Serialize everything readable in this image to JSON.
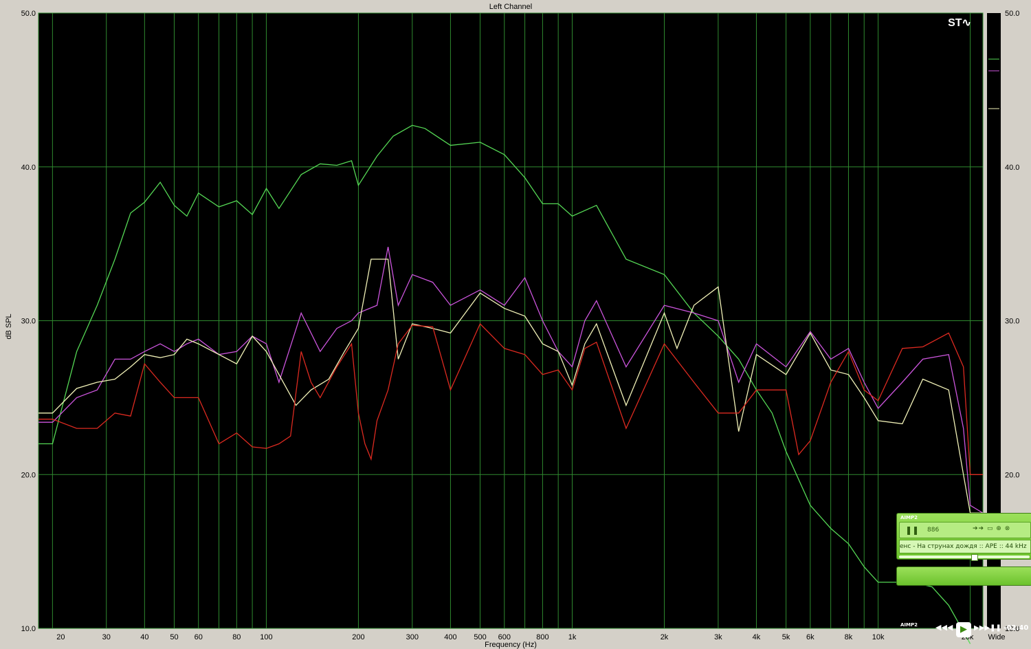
{
  "chart_data": {
    "type": "line",
    "title": "Left Channel",
    "xlabel": "Frequency (Hz)",
    "ylabel": "dB SPL",
    "xscale": "log",
    "xlim": [
      18,
      22000
    ],
    "ylim": [
      10,
      50
    ],
    "x_ticks": [
      {
        "v": 20,
        "label": "20"
      },
      {
        "v": 30,
        "label": "30"
      },
      {
        "v": 40,
        "label": "40"
      },
      {
        "v": 50,
        "label": "50"
      },
      {
        "v": 60,
        "label": "60"
      },
      {
        "v": 80,
        "label": "80"
      },
      {
        "v": 100,
        "label": "100"
      },
      {
        "v": 200,
        "label": "200"
      },
      {
        "v": 300,
        "label": "300"
      },
      {
        "v": 400,
        "label": "400"
      },
      {
        "v": 500,
        "label": "500"
      },
      {
        "v": 600,
        "label": "600"
      },
      {
        "v": 800,
        "label": "800"
      },
      {
        "v": 1000,
        "label": "1k"
      },
      {
        "v": 2000,
        "label": "2k"
      },
      {
        "v": 3000,
        "label": "3k"
      },
      {
        "v": 4000,
        "label": "4k"
      },
      {
        "v": 5000,
        "label": "5k"
      },
      {
        "v": 6000,
        "label": "6k"
      },
      {
        "v": 8000,
        "label": "8k"
      },
      {
        "v": 10000,
        "label": "10k"
      },
      {
        "v": 20000,
        "label": "20k"
      }
    ],
    "y_ticks": [
      {
        "v": 50,
        "label": "50.0"
      },
      {
        "v": 40,
        "label": "40.0"
      },
      {
        "v": 30,
        "label": "30.0"
      },
      {
        "v": 20,
        "label": "20.0"
      },
      {
        "v": 10,
        "label": "10.0"
      }
    ],
    "right_axis_extra_label": "Wide",
    "grid": true,
    "series": [
      {
        "color": "#55d855",
        "x": [
          18,
          20,
          24,
          28,
          32,
          36,
          40,
          45,
          50,
          55,
          60,
          70,
          80,
          90,
          100,
          110,
          130,
          150,
          170,
          190,
          200,
          230,
          260,
          300,
          330,
          400,
          500,
          600,
          700,
          800,
          900,
          1000,
          1200,
          1500,
          2000,
          2500,
          3000,
          3500,
          4000,
          4500,
          5000,
          6000,
          7000,
          8000,
          9000,
          10000,
          11000,
          13000,
          15000,
          17000,
          20000
        ],
        "y": [
          22,
          22,
          28,
          31,
          34,
          37,
          37.7,
          39,
          37.5,
          36.8,
          38.3,
          37.4,
          37.8,
          36.9,
          38.6,
          37.3,
          39.5,
          40.2,
          40.1,
          40.4,
          38.8,
          40.7,
          42,
          42.7,
          42.5,
          41.4,
          41.6,
          40.8,
          39.3,
          37.6,
          37.6,
          36.8,
          37.5,
          34,
          33,
          30.5,
          29,
          27.5,
          25.5,
          24,
          21.5,
          18,
          16.5,
          15.5,
          14,
          13,
          13,
          13,
          12.7,
          11.5,
          9
        ]
      },
      {
        "color": "#cc55dd",
        "x": [
          18,
          20,
          24,
          28,
          32,
          36,
          40,
          45,
          50,
          55,
          60,
          70,
          80,
          90,
          100,
          110,
          130,
          150,
          170,
          190,
          200,
          230,
          250,
          270,
          300,
          350,
          400,
          500,
          600,
          700,
          800,
          900,
          1000,
          1100,
          1200,
          1500,
          2000,
          2500,
          3000,
          3500,
          4000,
          5000,
          6000,
          7000,
          8000,
          9000,
          10000,
          12000,
          14000,
          17000,
          19000,
          20000,
          22000
        ],
        "y": [
          23.4,
          23.4,
          25,
          25.5,
          27.5,
          27.5,
          28,
          28.5,
          28,
          28.5,
          28.8,
          27.8,
          28,
          29,
          28.5,
          26,
          30.5,
          28,
          29.5,
          30,
          30.5,
          31,
          34.8,
          31,
          33,
          32.5,
          31,
          32,
          31,
          32.8,
          30,
          28,
          27,
          30,
          31.3,
          27,
          31,
          30.5,
          30,
          26,
          28.5,
          27,
          29.3,
          27.5,
          28.2,
          26,
          24.3,
          26,
          27.5,
          27.8,
          23,
          18,
          17.5
        ]
      },
      {
        "color": "#f2f2b8",
        "x": [
          18,
          20,
          24,
          28,
          32,
          36,
          40,
          45,
          50,
          55,
          60,
          70,
          80,
          90,
          100,
          110,
          125,
          140,
          160,
          180,
          200,
          220,
          250,
          270,
          300,
          350,
          400,
          500,
          600,
          700,
          800,
          900,
          1000,
          1100,
          1200,
          1500,
          2000,
          2200,
          2500,
          3000,
          3500,
          4000,
          5000,
          6000,
          7000,
          8000,
          9000,
          10000,
          12000,
          14000,
          17000,
          19000,
          20000,
          22000
        ],
        "y": [
          24,
          24,
          25.6,
          26,
          26.2,
          27,
          27.8,
          27.6,
          27.8,
          28.8,
          28.5,
          27.8,
          27.2,
          29,
          28,
          26.5,
          24.5,
          25.5,
          26.2,
          28,
          29.5,
          34,
          34,
          27.5,
          29.8,
          29.5,
          29.2,
          31.8,
          30.8,
          30.3,
          28.5,
          28,
          25.8,
          28.5,
          29.8,
          24.5,
          30.5,
          28.2,
          31,
          32.2,
          22.8,
          27.8,
          26.5,
          29.2,
          26.8,
          26.5,
          25,
          23.5,
          23.3,
          26.2,
          25.5,
          20,
          17.5,
          17.5
        ]
      },
      {
        "color": "#dd2a20",
        "x": [
          18,
          20,
          24,
          28,
          32,
          36,
          40,
          45,
          50,
          60,
          70,
          80,
          90,
          100,
          110,
          120,
          130,
          140,
          150,
          170,
          190,
          200,
          210,
          220,
          230,
          250,
          270,
          300,
          350,
          400,
          500,
          600,
          700,
          800,
          900,
          1000,
          1100,
          1200,
          1500,
          2000,
          2500,
          3000,
          3500,
          4000,
          5000,
          5500,
          6000,
          7000,
          8000,
          9000,
          10000,
          12000,
          14000,
          17000,
          19000,
          20000,
          22000
        ],
        "y": [
          23.6,
          23.6,
          23,
          23,
          24,
          23.8,
          27.2,
          26,
          25,
          25,
          22,
          22.7,
          21.8,
          21.7,
          22,
          22.5,
          28,
          26,
          25,
          27,
          28.5,
          24,
          22,
          21,
          23.5,
          25.5,
          28.5,
          29.7,
          29.6,
          25.5,
          29.8,
          28.2,
          27.8,
          26.5,
          26.8,
          25.5,
          28.2,
          28.6,
          23,
          28.5,
          26,
          24,
          24,
          25.5,
          25.5,
          21.3,
          22.2,
          26,
          28,
          25.5,
          24.8,
          28.2,
          28.3,
          29.2,
          27,
          20,
          20
        ]
      }
    ]
  },
  "aimp": {
    "logo": "AIMP2",
    "counter": "886",
    "controls": "➔➔ ▭ ⊕ ⊗",
    "track": "енс - На струнах дождя :: APE :: 44 kHz",
    "pause": "❚❚",
    "transport": "◀◀◀",
    "play": "▶",
    "time": "▶▶▶❚❚ -02:40"
  }
}
